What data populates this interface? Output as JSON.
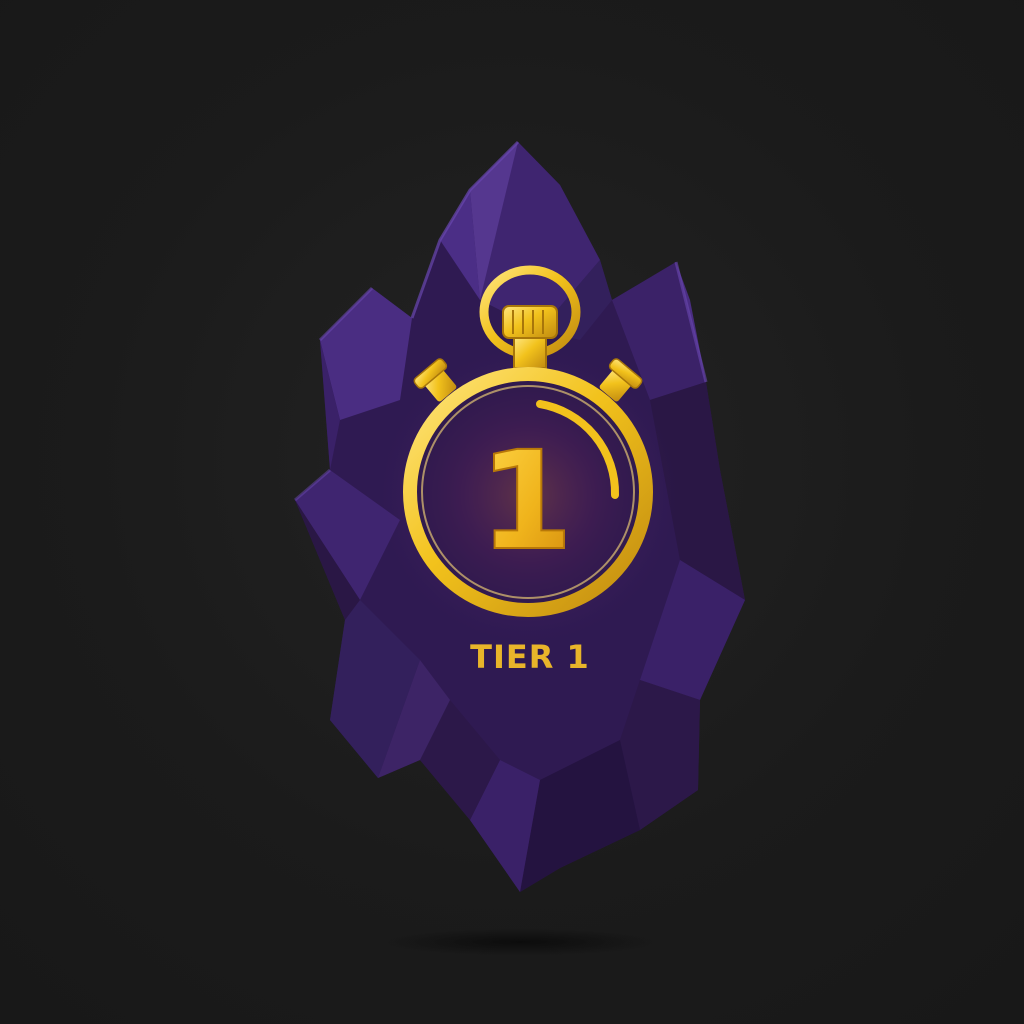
{
  "badge": {
    "number": "1",
    "label": "TIER 1",
    "icon": "stopwatch-icon",
    "material": "amethyst-crystal-icon"
  },
  "colors": {
    "background": "#1c1c1c",
    "crystal_dark": "#2a1745",
    "crystal_mid": "#3d2466",
    "crystal_light": "#58389a",
    "gold": "#f2c21c",
    "gold_dark": "#b8860b",
    "glow": "#ff7a30"
  }
}
